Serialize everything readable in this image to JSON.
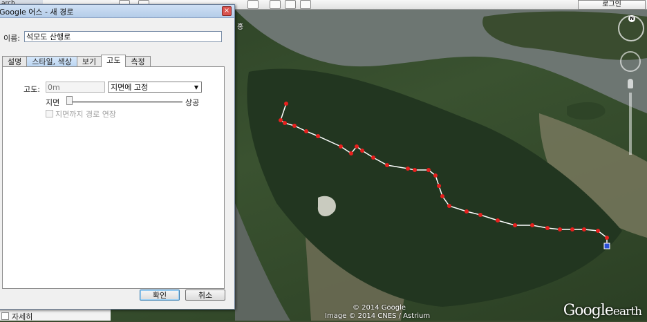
{
  "left_panel": {
    "search_tab": "arch",
    "detail_item": "자세히"
  },
  "toolbar": {
    "login_label": "로그인"
  },
  "dialog": {
    "title": "Google 어스 - 새 경로",
    "name_label": "이름:",
    "name_value": "석모도 산행로",
    "tabs": [
      {
        "label": "설명"
      },
      {
        "label": "스타일, 색상"
      },
      {
        "label": "보기"
      },
      {
        "label": "고도"
      },
      {
        "label": "측정"
      }
    ],
    "active_tab": "고도",
    "altitude": {
      "label": "고도:",
      "placeholder": "0m",
      "mode_selected": "지면에 고정",
      "slider_min_label": "지면",
      "slider_max_label": "상공",
      "extend_label": "지면까지 경로 연장",
      "extend_checked": false
    },
    "ok_label": "확인",
    "cancel_label": "취소"
  },
  "map": {
    "place_label": "홍",
    "credit_copyright": "© 2014 Google",
    "credit_imagery": "Image © 2014 CNES / Astrium",
    "logo_google": "Google",
    "logo_earth": "earth",
    "compass_north": "N",
    "path_color": "#ffffff",
    "waypoint_color": "#e8201e"
  }
}
